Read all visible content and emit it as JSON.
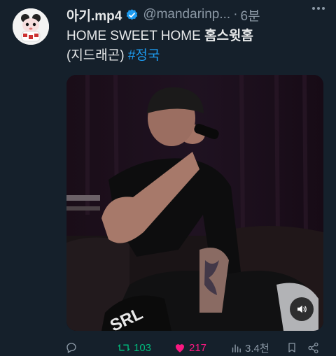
{
  "tweet": {
    "display_name": "아기.mp4",
    "handle": "@mandarinp...",
    "separator": "·",
    "time": "6분",
    "text_line1_a": "HOME SWEET HOME ",
    "text_line1_b": "홈스윗홈",
    "text_line2_a": "(지드래곤) ",
    "hashtag": "#정국"
  },
  "media": {
    "type": "video",
    "sound_icon": "speaker-muted-icon"
  },
  "actions": {
    "reply_count": "",
    "retweet_count": "103",
    "like_count": "217",
    "views_count": "3.4천"
  },
  "colors": {
    "background": "#15202b",
    "text": "#e7e9ea",
    "muted": "#8b98a5",
    "link": "#1d9bf0",
    "verified": "#1d9bf0",
    "retweet": "#00ba7c",
    "like": "#f91880"
  }
}
